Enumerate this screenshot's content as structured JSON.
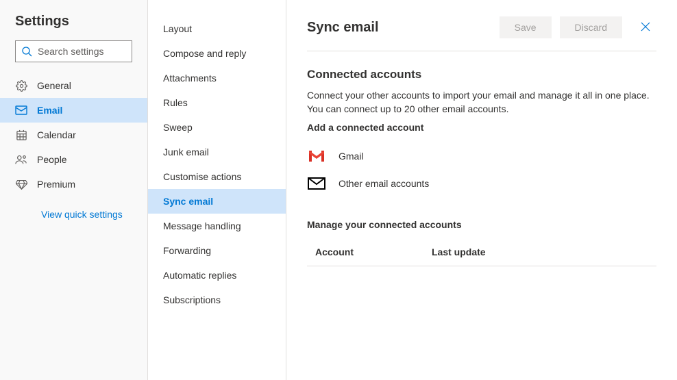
{
  "left": {
    "title": "Settings",
    "searchPlaceholder": "Search settings",
    "items": [
      {
        "label": "General"
      },
      {
        "label": "Email"
      },
      {
        "label": "Calendar"
      },
      {
        "label": "People"
      },
      {
        "label": "Premium"
      }
    ],
    "quickLink": "View quick settings"
  },
  "mid": {
    "items": [
      {
        "label": "Layout"
      },
      {
        "label": "Compose and reply"
      },
      {
        "label": "Attachments"
      },
      {
        "label": "Rules"
      },
      {
        "label": "Sweep"
      },
      {
        "label": "Junk email"
      },
      {
        "label": "Customise actions"
      },
      {
        "label": "Sync email"
      },
      {
        "label": "Message handling"
      },
      {
        "label": "Forwarding"
      },
      {
        "label": "Automatic replies"
      },
      {
        "label": "Subscriptions"
      }
    ]
  },
  "right": {
    "title": "Sync email",
    "save": "Save",
    "discard": "Discard",
    "connectedHeading": "Connected accounts",
    "connectedDescription": "Connect your other accounts to import your email and manage it all in one place. You can connect up to 20 other email accounts.",
    "addLabel": "Add a connected account",
    "providers": [
      {
        "label": "Gmail"
      },
      {
        "label": "Other email accounts"
      }
    ],
    "manageHeading": "Manage your connected accounts",
    "columns": {
      "account": "Account",
      "lastUpdate": "Last update"
    }
  }
}
